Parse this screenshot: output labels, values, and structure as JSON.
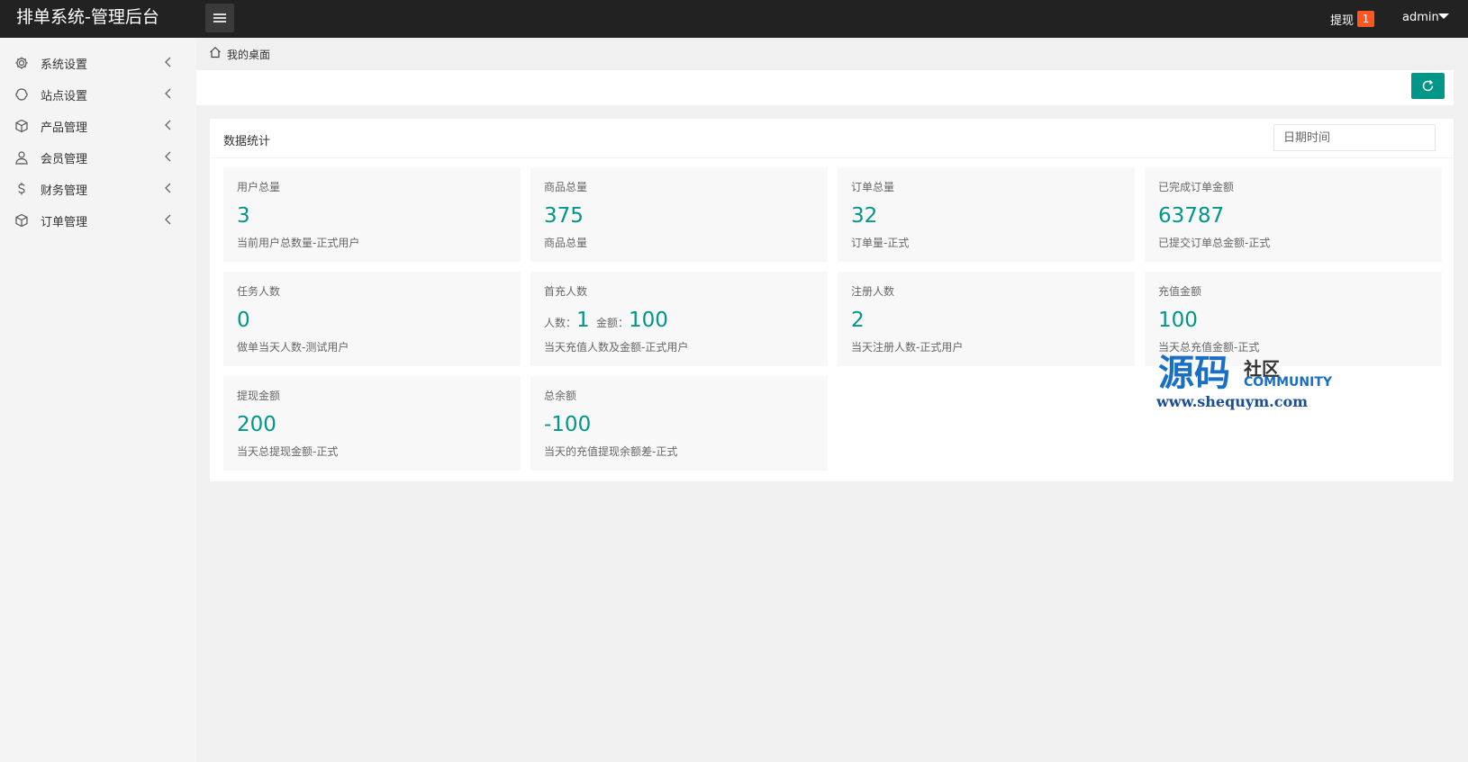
{
  "header": {
    "title": "排单系统-管理后台",
    "withdraw_label": "提现",
    "withdraw_badge": "1",
    "user_name": "admin"
  },
  "sidebar": {
    "items": [
      {
        "label": "系统设置",
        "icon": "gear-icon"
      },
      {
        "label": "站点设置",
        "icon": "site-icon"
      },
      {
        "label": "产品管理",
        "icon": "box-icon"
      },
      {
        "label": "会员管理",
        "icon": "user-icon"
      },
      {
        "label": "财务管理",
        "icon": "dollar-icon"
      },
      {
        "label": "订单管理",
        "icon": "order-box-icon"
      }
    ]
  },
  "breadcrumb": {
    "label": "我的桌面"
  },
  "panel": {
    "title": "数据统计",
    "date_placeholder": "日期时间"
  },
  "stats": [
    {
      "label": "用户总量",
      "value": "3",
      "desc": "当前用户总数量-正式用户"
    },
    {
      "label": "商品总量",
      "value": "375",
      "desc": "商品总量"
    },
    {
      "label": "订单总量",
      "value": "32",
      "desc": "订单量-正式"
    },
    {
      "label": "已完成订单金额",
      "value": "63787",
      "desc": "已提交订单总金额-正式"
    },
    {
      "label": "任务人数",
      "value": "0",
      "desc": "做单当天人数-测试用户"
    },
    {
      "label": "首充人数",
      "count_label": "人数：",
      "count": "1",
      "amount_label": "金额：",
      "amount": "100",
      "desc": "当天充值人数及金额-正式用户"
    },
    {
      "label": "注册人数",
      "value": "2",
      "desc": "当天注册人数-正式用户"
    },
    {
      "label": "充值金额",
      "value": "100",
      "desc": "当天总充值金额-正式"
    },
    {
      "label": "提现金额",
      "value": "200",
      "desc": "当天总提现金额-正式"
    },
    {
      "label": "总余额",
      "value": "-100",
      "desc": "当天的充值提现余额差-正式"
    }
  ],
  "watermark": {
    "main": "源码",
    "she": "社区",
    "community": "COMMUNITY",
    "url": "www.shequym.com"
  },
  "colors": {
    "header_bg": "#222222",
    "accent": "#009688",
    "badge": "#ff5722"
  }
}
